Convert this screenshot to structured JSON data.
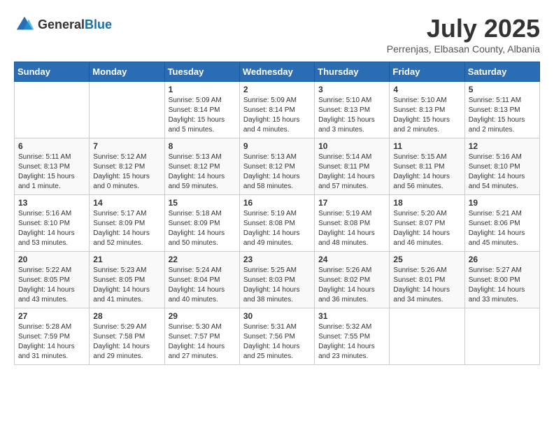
{
  "header": {
    "logo_general": "General",
    "logo_blue": "Blue",
    "month_year": "July 2025",
    "location": "Perrenjas, Elbasan County, Albania"
  },
  "weekdays": [
    "Sunday",
    "Monday",
    "Tuesday",
    "Wednesday",
    "Thursday",
    "Friday",
    "Saturday"
  ],
  "weeks": [
    [
      {
        "day": "",
        "info": ""
      },
      {
        "day": "",
        "info": ""
      },
      {
        "day": "1",
        "info": "Sunrise: 5:09 AM\nSunset: 8:14 PM\nDaylight: 15 hours and 5 minutes."
      },
      {
        "day": "2",
        "info": "Sunrise: 5:09 AM\nSunset: 8:14 PM\nDaylight: 15 hours and 4 minutes."
      },
      {
        "day": "3",
        "info": "Sunrise: 5:10 AM\nSunset: 8:13 PM\nDaylight: 15 hours and 3 minutes."
      },
      {
        "day": "4",
        "info": "Sunrise: 5:10 AM\nSunset: 8:13 PM\nDaylight: 15 hours and 2 minutes."
      },
      {
        "day": "5",
        "info": "Sunrise: 5:11 AM\nSunset: 8:13 PM\nDaylight: 15 hours and 2 minutes."
      }
    ],
    [
      {
        "day": "6",
        "info": "Sunrise: 5:11 AM\nSunset: 8:13 PM\nDaylight: 15 hours and 1 minute."
      },
      {
        "day": "7",
        "info": "Sunrise: 5:12 AM\nSunset: 8:12 PM\nDaylight: 15 hours and 0 minutes."
      },
      {
        "day": "8",
        "info": "Sunrise: 5:13 AM\nSunset: 8:12 PM\nDaylight: 14 hours and 59 minutes."
      },
      {
        "day": "9",
        "info": "Sunrise: 5:13 AM\nSunset: 8:12 PM\nDaylight: 14 hours and 58 minutes."
      },
      {
        "day": "10",
        "info": "Sunrise: 5:14 AM\nSunset: 8:11 PM\nDaylight: 14 hours and 57 minutes."
      },
      {
        "day": "11",
        "info": "Sunrise: 5:15 AM\nSunset: 8:11 PM\nDaylight: 14 hours and 56 minutes."
      },
      {
        "day": "12",
        "info": "Sunrise: 5:16 AM\nSunset: 8:10 PM\nDaylight: 14 hours and 54 minutes."
      }
    ],
    [
      {
        "day": "13",
        "info": "Sunrise: 5:16 AM\nSunset: 8:10 PM\nDaylight: 14 hours and 53 minutes."
      },
      {
        "day": "14",
        "info": "Sunrise: 5:17 AM\nSunset: 8:09 PM\nDaylight: 14 hours and 52 minutes."
      },
      {
        "day": "15",
        "info": "Sunrise: 5:18 AM\nSunset: 8:09 PM\nDaylight: 14 hours and 50 minutes."
      },
      {
        "day": "16",
        "info": "Sunrise: 5:19 AM\nSunset: 8:08 PM\nDaylight: 14 hours and 49 minutes."
      },
      {
        "day": "17",
        "info": "Sunrise: 5:19 AM\nSunset: 8:08 PM\nDaylight: 14 hours and 48 minutes."
      },
      {
        "day": "18",
        "info": "Sunrise: 5:20 AM\nSunset: 8:07 PM\nDaylight: 14 hours and 46 minutes."
      },
      {
        "day": "19",
        "info": "Sunrise: 5:21 AM\nSunset: 8:06 PM\nDaylight: 14 hours and 45 minutes."
      }
    ],
    [
      {
        "day": "20",
        "info": "Sunrise: 5:22 AM\nSunset: 8:05 PM\nDaylight: 14 hours and 43 minutes."
      },
      {
        "day": "21",
        "info": "Sunrise: 5:23 AM\nSunset: 8:05 PM\nDaylight: 14 hours and 41 minutes."
      },
      {
        "day": "22",
        "info": "Sunrise: 5:24 AM\nSunset: 8:04 PM\nDaylight: 14 hours and 40 minutes."
      },
      {
        "day": "23",
        "info": "Sunrise: 5:25 AM\nSunset: 8:03 PM\nDaylight: 14 hours and 38 minutes."
      },
      {
        "day": "24",
        "info": "Sunrise: 5:26 AM\nSunset: 8:02 PM\nDaylight: 14 hours and 36 minutes."
      },
      {
        "day": "25",
        "info": "Sunrise: 5:26 AM\nSunset: 8:01 PM\nDaylight: 14 hours and 34 minutes."
      },
      {
        "day": "26",
        "info": "Sunrise: 5:27 AM\nSunset: 8:00 PM\nDaylight: 14 hours and 33 minutes."
      }
    ],
    [
      {
        "day": "27",
        "info": "Sunrise: 5:28 AM\nSunset: 7:59 PM\nDaylight: 14 hours and 31 minutes."
      },
      {
        "day": "28",
        "info": "Sunrise: 5:29 AM\nSunset: 7:58 PM\nDaylight: 14 hours and 29 minutes."
      },
      {
        "day": "29",
        "info": "Sunrise: 5:30 AM\nSunset: 7:57 PM\nDaylight: 14 hours and 27 minutes."
      },
      {
        "day": "30",
        "info": "Sunrise: 5:31 AM\nSunset: 7:56 PM\nDaylight: 14 hours and 25 minutes."
      },
      {
        "day": "31",
        "info": "Sunrise: 5:32 AM\nSunset: 7:55 PM\nDaylight: 14 hours and 23 minutes."
      },
      {
        "day": "",
        "info": ""
      },
      {
        "day": "",
        "info": ""
      }
    ]
  ]
}
